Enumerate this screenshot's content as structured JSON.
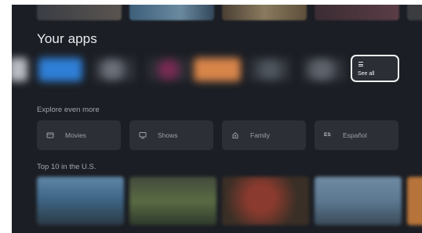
{
  "sections": {
    "apps_title": "Your apps",
    "explore_title": "Explore even more",
    "top10_title": "Top 10 in the U.S."
  },
  "see_all": {
    "label": "See all",
    "icon": "menu-icon"
  },
  "explore_chips": [
    {
      "label": "Movies",
      "icon": "movie-icon"
    },
    {
      "label": "Shows",
      "icon": "tv-icon"
    },
    {
      "label": "Family",
      "icon": "family-icon"
    },
    {
      "label": "Español",
      "icon": "es-badge",
      "badge": "ES"
    }
  ],
  "colors": {
    "background": "#1b1e24",
    "chip": "#2c2f36",
    "focus_border": "#f1f2f4"
  }
}
